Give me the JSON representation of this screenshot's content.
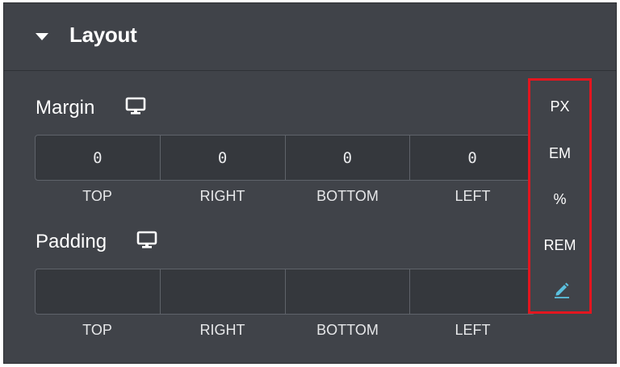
{
  "section": {
    "title": "Layout",
    "caret_icon": "caret-down-icon"
  },
  "margin": {
    "label": "Margin",
    "device_icon": "desktop-monitor-icon",
    "values": {
      "top": "0",
      "right": "0",
      "bottom": "0",
      "left": "0"
    },
    "labels": {
      "top": "TOP",
      "right": "RIGHT",
      "bottom": "BOTTOM",
      "left": "LEFT"
    }
  },
  "padding": {
    "label": "Padding",
    "device_icon": "desktop-monitor-icon",
    "values": {
      "top": "",
      "right": "",
      "bottom": "",
      "left": ""
    },
    "labels": {
      "top": "TOP",
      "right": "RIGHT",
      "bottom": "BOTTOM",
      "left": "LEFT"
    }
  },
  "units": {
    "options": [
      "PX",
      "EM",
      "%",
      "REM"
    ],
    "custom_icon": "pencil-icon",
    "highlight_color": "#e3161f",
    "accent_color": "#5bc0de"
  }
}
